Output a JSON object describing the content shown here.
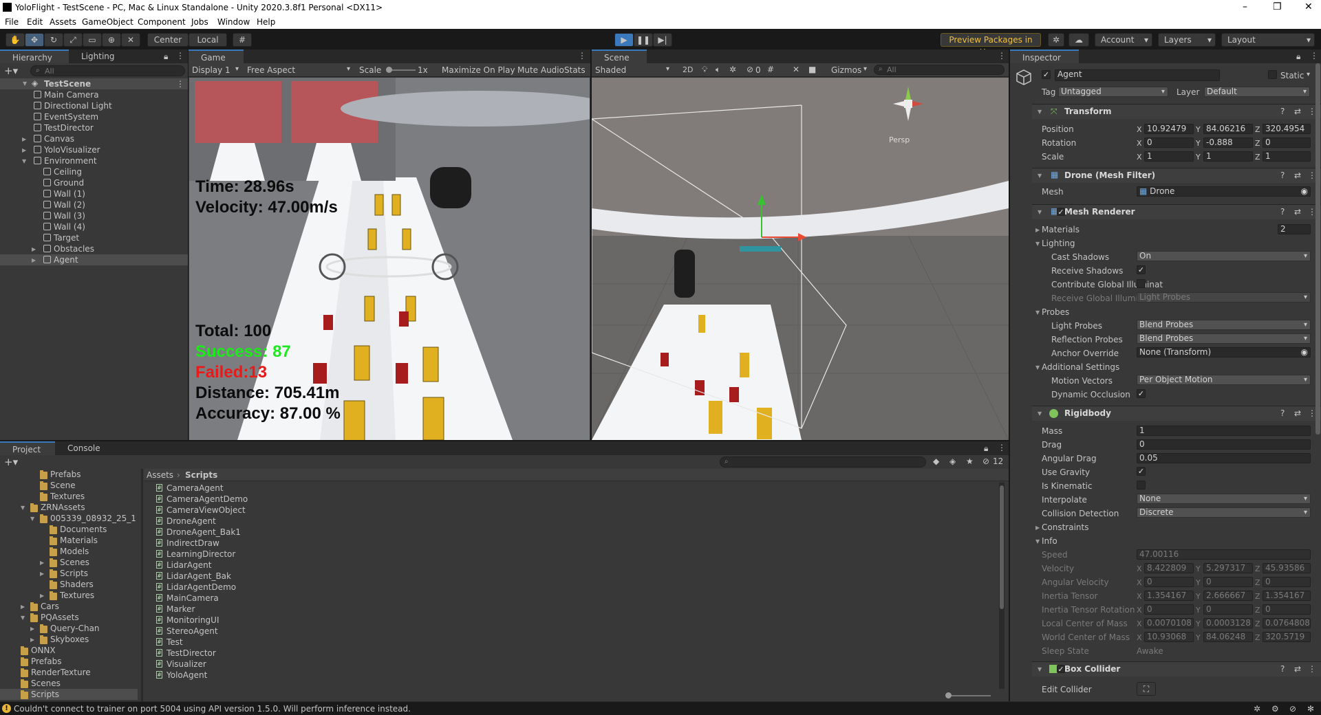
{
  "window": {
    "title": "YoloFlight - TestScene - PC, Mac & Linux Standalone - Unity 2020.3.8f1 Personal <DX11>"
  },
  "menu": [
    "File",
    "Edit",
    "Assets",
    "GameObject",
    "Component",
    "Jobs",
    "Window",
    "Help"
  ],
  "toolbar": {
    "pivot_label": "Center",
    "space_label": "Local",
    "preview_packages": "Preview Packages in Use",
    "account": "Account",
    "layers": "Layers",
    "layout": "Layout"
  },
  "hierarchy": {
    "tab": "Hierarchy",
    "tab2": "Lighting",
    "search_placeholder": "All",
    "scene": "TestScene",
    "items": [
      {
        "label": "Main Camera",
        "depth": 1,
        "fold": false
      },
      {
        "label": "Directional Light",
        "depth": 1,
        "fold": false
      },
      {
        "label": "EventSystem",
        "depth": 1,
        "fold": false
      },
      {
        "label": "TestDirector",
        "depth": 1,
        "fold": false
      },
      {
        "label": "Canvas",
        "depth": 1,
        "fold": "closed"
      },
      {
        "label": "YoloVisualizer",
        "depth": 1,
        "fold": "closed"
      },
      {
        "label": "Environment",
        "depth": 1,
        "fold": "open"
      },
      {
        "label": "Ceiling",
        "depth": 2,
        "fold": false
      },
      {
        "label": "Ground",
        "depth": 2,
        "fold": false
      },
      {
        "label": "Wall (1)",
        "depth": 2,
        "fold": false
      },
      {
        "label": "Wall (2)",
        "depth": 2,
        "fold": false
      },
      {
        "label": "Wall (3)",
        "depth": 2,
        "fold": false
      },
      {
        "label": "Wall (4)",
        "depth": 2,
        "fold": false
      },
      {
        "label": "Target",
        "depth": 2,
        "fold": false
      },
      {
        "label": "Obstacles",
        "depth": 2,
        "fold": "closed"
      },
      {
        "label": "Agent",
        "depth": 2,
        "fold": "closed"
      }
    ]
  },
  "game": {
    "tab": "Game",
    "display": "Display 1",
    "aspect": "Free Aspect",
    "scale_label": "Scale",
    "scale_value": "1x",
    "maximize": "Maximize On Play",
    "mute": "Mute Audio",
    "stats": "Stats",
    "hud": {
      "time": "Time: 28.96s",
      "velocity": "Velocity: 47.00m/s",
      "total": "Total: 100",
      "success": "Success: 87",
      "failed": "Failed:13",
      "distance": "Distance: 705.41m",
      "accuracy": "Accuracy: 87.00 %"
    }
  },
  "scene": {
    "tab": "Scene",
    "shading": "Shaded",
    "mode_2d": "2D",
    "hidden_count": "0",
    "gizmos": "Gizmos",
    "search_placeholder": "All",
    "persp": "Persp"
  },
  "project": {
    "tab": "Project",
    "tab2": "Console",
    "hidden_count": "12",
    "breadcrumb_root": "Assets",
    "breadcrumb_current": "Scripts",
    "tree": [
      {
        "label": "Prefabs",
        "depth": 2,
        "fold": false
      },
      {
        "label": "Scene",
        "depth": 2,
        "fold": false
      },
      {
        "label": "Textures",
        "depth": 2,
        "fold": false
      },
      {
        "label": "ZRNAssets",
        "depth": 1,
        "fold": "open"
      },
      {
        "label": "005339_08932_25_1",
        "depth": 2,
        "fold": "open"
      },
      {
        "label": "Documents",
        "depth": 3,
        "fold": false
      },
      {
        "label": "Materials",
        "depth": 3,
        "fold": false
      },
      {
        "label": "Models",
        "depth": 3,
        "fold": false
      },
      {
        "label": "Scenes",
        "depth": 3,
        "fold": "closed"
      },
      {
        "label": "Scripts",
        "depth": 3,
        "fold": "closed"
      },
      {
        "label": "Shaders",
        "depth": 3,
        "fold": false
      },
      {
        "label": "Textures",
        "depth": 3,
        "fold": "closed"
      },
      {
        "label": "Cars",
        "depth": 1,
        "fold": "closed"
      },
      {
        "label": "PQAssets",
        "depth": 1,
        "fold": "open"
      },
      {
        "label": "Query-Chan",
        "depth": 2,
        "fold": "closed"
      },
      {
        "label": "Skyboxes",
        "depth": 2,
        "fold": "closed"
      },
      {
        "label": "ONNX",
        "depth": 0,
        "fold": false
      },
      {
        "label": "Prefabs",
        "depth": 0,
        "fold": false
      },
      {
        "label": "RenderTexture",
        "depth": 0,
        "fold": false
      },
      {
        "label": "Scenes",
        "depth": 0,
        "fold": false
      },
      {
        "label": "Scripts",
        "depth": 0,
        "fold": false
      }
    ],
    "scripts": [
      "CameraAgent",
      "CameraAgentDemo",
      "CameraViewObject",
      "DroneAgent",
      "DroneAgent_Bak1",
      "IndirectDraw",
      "LearningDirector",
      "LidarAgent",
      "LidarAgent_Bak",
      "LidarAgentDemo",
      "MainCamera",
      "Marker",
      "MonitoringUI",
      "StereoAgent",
      "Test",
      "TestDirector",
      "Visualizer",
      "YoloAgent"
    ]
  },
  "inspector": {
    "tab": "Inspector",
    "object_name": "Agent",
    "static_label": "Static",
    "tag_label": "Tag",
    "tag_value": "Untagged",
    "layer_label": "Layer",
    "layer_value": "Default",
    "transform": {
      "title": "Transform",
      "position_label": "Position",
      "position": [
        "10.92479",
        "84.06216",
        "320.4954"
      ],
      "rotation_label": "Rotation",
      "rotation": [
        "0",
        "-0.888",
        "0"
      ],
      "scale_label": "Scale",
      "scale": [
        "1",
        "1",
        "1"
      ]
    },
    "mesh_filter": {
      "title": "Drone (Mesh Filter)",
      "mesh_label": "Mesh",
      "mesh_value": "Drone"
    },
    "mesh_renderer": {
      "title": "Mesh Renderer",
      "materials_label": "Materials",
      "materials_count": "2",
      "lighting_label": "Lighting",
      "cast_shadows_label": "Cast Shadows",
      "cast_shadows": "On",
      "receive_shadows_label": "Receive Shadows",
      "contrib_gi_label": "Contribute Global Illuminat",
      "receive_gi_label": "Receive Global Illuminatior",
      "receive_gi": "Light Probes",
      "probes_label": "Probes",
      "light_probes_label": "Light Probes",
      "light_probes": "Blend Probes",
      "reflection_probes_label": "Reflection Probes",
      "reflection_probes": "Blend Probes",
      "anchor_label": "Anchor Override",
      "anchor": "None (Transform)",
      "additional_label": "Additional Settings",
      "motion_label": "Motion Vectors",
      "motion": "Per Object Motion",
      "occlusion_label": "Dynamic Occlusion"
    },
    "rigidbody": {
      "title": "Rigidbody",
      "mass_label": "Mass",
      "mass": "1",
      "drag_label": "Drag",
      "drag": "0",
      "angular_drag_label": "Angular Drag",
      "angular_drag": "0.05",
      "gravity_label": "Use Gravity",
      "kinematic_label": "Is Kinematic",
      "interpolate_label": "Interpolate",
      "interpolate": "None",
      "collision_label": "Collision Detection",
      "collision": "Discrete",
      "constraints_label": "Constraints",
      "info_label": "Info",
      "speed_label": "Speed",
      "speed": "47.00116",
      "velocity_label": "Velocity",
      "velocity": [
        "8.422809",
        "5.297317",
        "45.93586"
      ],
      "ang_vel_label": "Angular Velocity",
      "ang_vel": [
        "0",
        "0",
        "0"
      ],
      "inertia_label": "Inertia Tensor",
      "inertia": [
        "1.354167",
        "2.666667",
        "1.354167"
      ],
      "inertia_rot_label": "Inertia Tensor Rotation",
      "inertia_rot": [
        "0",
        "0",
        "0"
      ],
      "local_com_label": "Local Center of Mass",
      "local_com": [
        "0.0070108",
        "0.0003128",
        "0.0764808"
      ],
      "world_com_label": "World Center of Mass",
      "world_com": [
        "10.93068",
        "84.06248",
        "320.5719"
      ],
      "sleep_label": "Sleep State",
      "sleep": "Awake"
    },
    "box_collider": {
      "title": "Box Collider",
      "edit_label": "Edit Collider"
    }
  },
  "status": {
    "message": "Couldn't connect to trainer on port 5004 using API version 1.5.0. Will perform inference instead."
  },
  "colors": {
    "accent": "#3a79bb",
    "success": "#1ee81e",
    "failed": "#e81a1a",
    "selected": "#2c5d87"
  }
}
